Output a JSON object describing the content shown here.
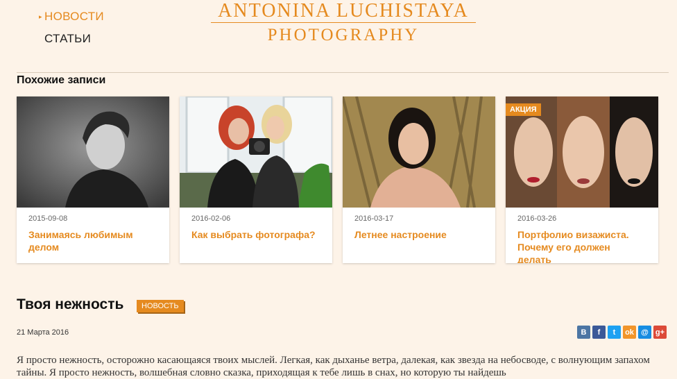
{
  "nav": {
    "items": [
      {
        "label": "НОВОСТИ",
        "active": true
      },
      {
        "label": "СТАТЬИ",
        "active": false
      }
    ]
  },
  "logo": {
    "line1": "ANTONINA LUCHISTAYA",
    "line2": "PHOTOGRAPHY"
  },
  "related": {
    "title": "Похожие записи",
    "cards": [
      {
        "date": "2015-09-08",
        "title": "Занимаясь любимым делом",
        "badge": ""
      },
      {
        "date": "2016-02-06",
        "title": "Как выбрать фотографа?",
        "badge": ""
      },
      {
        "date": "2016-03-17",
        "title": "Летнее настроение",
        "badge": ""
      },
      {
        "date": "2016-03-26",
        "title": "Портфолио визажиста. Почему его должен делать",
        "badge": "АКЦИЯ"
      }
    ]
  },
  "post": {
    "title": "Твоя нежность",
    "tag": "НОВОСТЬ",
    "date": "21 Марта 2016",
    "body": " Я просто нежность, осторожно касающаяся твоих мыслей. Легкая, как дыханье ветра, далекая, как звезда на небосводе, с волнующим запахом тайны. Я просто нежность, волшебная словно сказка, приходящая к тебе лишь в снах, но которую ты найдешь"
  },
  "share": {
    "items": [
      {
        "label": "В",
        "color": "#4c75a3"
      },
      {
        "label": "f",
        "color": "#3b5998"
      },
      {
        "label": "t",
        "color": "#1da1f2"
      },
      {
        "label": "ok",
        "color": "#f2952a"
      },
      {
        "label": "@",
        "color": "#168de2"
      },
      {
        "label": "g+",
        "color": "#dc4a38"
      }
    ]
  },
  "colors": {
    "accent": "#e58a1f",
    "background": "#fdf3e8"
  }
}
